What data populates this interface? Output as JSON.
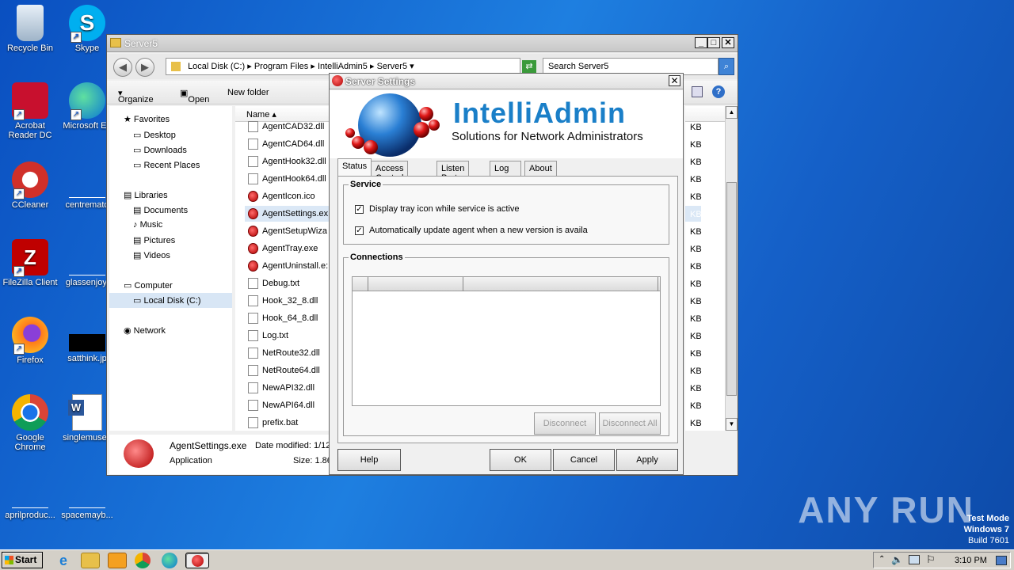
{
  "desktop": {
    "icons": [
      {
        "label": "Recycle Bin",
        "icon": "recycle-bin-icon"
      },
      {
        "label": "Skype",
        "icon": "skype-icon"
      },
      {
        "label": "Acrobat Reader DC",
        "icon": "acrobat-icon"
      },
      {
        "label": "Microsoft Ed",
        "icon": "edge-icon"
      },
      {
        "label": "CCleaner",
        "icon": "ccleaner-icon"
      },
      {
        "label": "centremato",
        "icon": "blank-file-icon"
      },
      {
        "label": "FileZilla Client",
        "icon": "filezilla-icon"
      },
      {
        "label": "glassenjoy.",
        "icon": "blank-file-icon"
      },
      {
        "label": "Firefox",
        "icon": "firefox-icon"
      },
      {
        "label": "satthink.jp",
        "icon": "image-file-icon"
      },
      {
        "label": "Google Chrome",
        "icon": "chrome-icon"
      },
      {
        "label": "singlemuseu",
        "icon": "word-doc-icon"
      },
      {
        "label": "aprilproduc...",
        "icon": "blank-file-icon"
      },
      {
        "label": "spacemayb...",
        "icon": "blank-file-icon"
      }
    ]
  },
  "explorer": {
    "title": "Server5",
    "breadcrumb": [
      "Local Disk (C:)",
      "Program Files",
      "IntelliAdmin5",
      "Server5"
    ],
    "search_placeholder": "Search Server5",
    "toolbar": {
      "organize": "Organize",
      "open": "Open",
      "new_folder": "New folder"
    },
    "nav": {
      "favorites": "Favorites",
      "desktop": "Desktop",
      "downloads": "Downloads",
      "recent": "Recent Places",
      "libraries": "Libraries",
      "documents": "Documents",
      "music": "Music",
      "pictures": "Pictures",
      "videos": "Videos",
      "computer": "Computer",
      "local_disk": "Local Disk (C:)",
      "network": "Network"
    },
    "column_name": "Name",
    "files": [
      "AgentCAD32.dll",
      "AgentCAD64.dll",
      "AgentHook32.dll",
      "AgentHook64.dll",
      "AgentIcon.ico",
      "AgentSettings.ex",
      "AgentSetupWiza",
      "AgentTray.exe",
      "AgentUninstall.e:",
      "Debug.txt",
      "Hook_32_8.dll",
      "Hook_64_8.dll",
      "Log.txt",
      "NetRoute32.dll",
      "NetRoute64.dll",
      "NewAPI32.dll",
      "NewAPI64.dll",
      "prefix.bat"
    ],
    "size_unit": "KB",
    "details": {
      "name": "AgentSettings.exe",
      "modified_label": "Date modified: 1/12",
      "type": "Application",
      "size_label": "Size: 1.86"
    }
  },
  "dialog": {
    "title": "Server Settings",
    "logo_text": "IntelliAdmin",
    "tagline": "Solutions for Network Administrators",
    "tabs": [
      "Status",
      "Access Control",
      "Listen Ports",
      "Log",
      "About"
    ],
    "service_legend": "Service",
    "checkbox1": "Display tray icon while service is active",
    "checkbox2": "Automatically update agent when a new version is availa",
    "checkbox1_checked": true,
    "checkbox2_checked": true,
    "connections_legend": "Connections",
    "disconnect": "Disconnect",
    "disconnect_all": "Disconnect All",
    "help": "Help",
    "ok": "OK",
    "cancel": "Cancel",
    "apply": "Apply"
  },
  "taskbar": {
    "start": "Start",
    "clock": "3:10 PM"
  },
  "watermark": {
    "brand": "ANY RUN",
    "mode": "Test Mode",
    "os": "Windows 7",
    "build": "Build 7601"
  }
}
